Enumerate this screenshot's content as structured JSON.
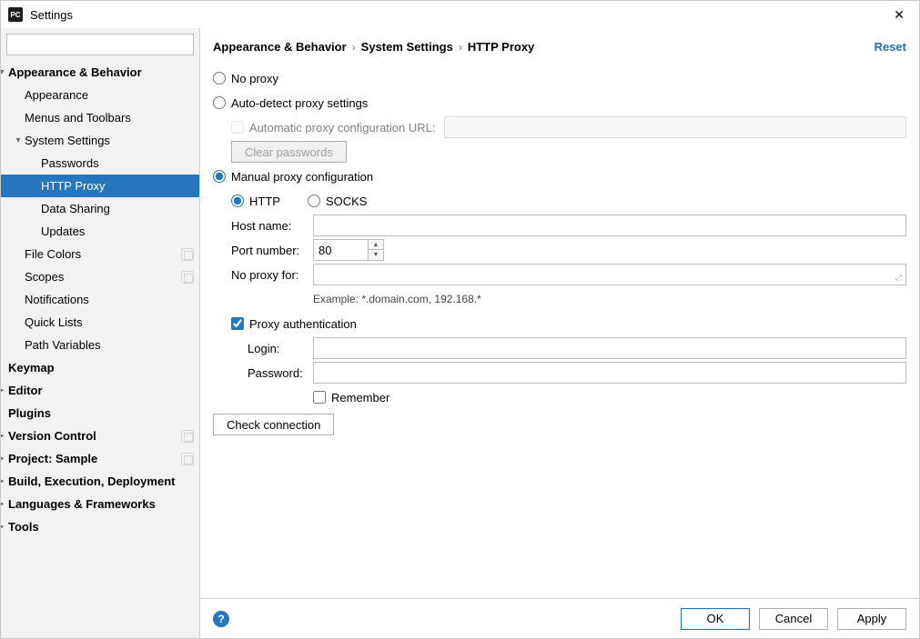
{
  "window": {
    "title": "Settings"
  },
  "sidebar": {
    "search_placeholder": "",
    "items": [
      {
        "label": "Appearance & Behavior",
        "indent": 0,
        "bold": true,
        "arrow": "down"
      },
      {
        "label": "Appearance",
        "indent": 1
      },
      {
        "label": "Menus and Toolbars",
        "indent": 1
      },
      {
        "label": "System Settings",
        "indent": 1,
        "arrow": "down"
      },
      {
        "label": "Passwords",
        "indent": 2
      },
      {
        "label": "HTTP Proxy",
        "indent": 2,
        "selected": true
      },
      {
        "label": "Data Sharing",
        "indent": 2
      },
      {
        "label": "Updates",
        "indent": 2
      },
      {
        "label": "File Colors",
        "indent": 1,
        "tag": true
      },
      {
        "label": "Scopes",
        "indent": 1,
        "tag": true
      },
      {
        "label": "Notifications",
        "indent": 1
      },
      {
        "label": "Quick Lists",
        "indent": 1
      },
      {
        "label": "Path Variables",
        "indent": 1
      },
      {
        "label": "Keymap",
        "indent": 0,
        "bold": true
      },
      {
        "label": "Editor",
        "indent": 0,
        "bold": true,
        "arrow": "right"
      },
      {
        "label": "Plugins",
        "indent": 0,
        "bold": true
      },
      {
        "label": "Version Control",
        "indent": 0,
        "bold": true,
        "arrow": "right",
        "tag": true
      },
      {
        "label": "Project: Sample",
        "indent": 0,
        "bold": true,
        "arrow": "right",
        "tag": true
      },
      {
        "label": "Build, Execution, Deployment",
        "indent": 0,
        "bold": true,
        "arrow": "right"
      },
      {
        "label": "Languages & Frameworks",
        "indent": 0,
        "bold": true,
        "arrow": "right"
      },
      {
        "label": "Tools",
        "indent": 0,
        "bold": true,
        "arrow": "right"
      }
    ]
  },
  "breadcrumb": {
    "a": "Appearance & Behavior",
    "b": "System Settings",
    "c": "HTTP Proxy"
  },
  "header": {
    "reset": "Reset"
  },
  "proxy": {
    "no_proxy": "No proxy",
    "auto_detect": "Auto-detect proxy settings",
    "auto_url_label": "Automatic proxy configuration URL:",
    "clear_passwords": "Clear passwords",
    "manual": "Manual proxy configuration",
    "http": "HTTP",
    "socks": "SOCKS",
    "host_label": "Host name:",
    "host_value": "",
    "port_label": "Port number:",
    "port_value": "80",
    "noproxy_label": "No proxy for:",
    "noproxy_value": "",
    "noproxy_hint": "Example: *.domain.com, 192.168.*",
    "auth_label": "Proxy authentication",
    "login_label": "Login:",
    "login_value": "",
    "password_label": "Password:",
    "password_value": "",
    "remember_label": "Remember",
    "check_connection": "Check connection"
  },
  "footer": {
    "ok": "OK",
    "cancel": "Cancel",
    "apply": "Apply"
  }
}
